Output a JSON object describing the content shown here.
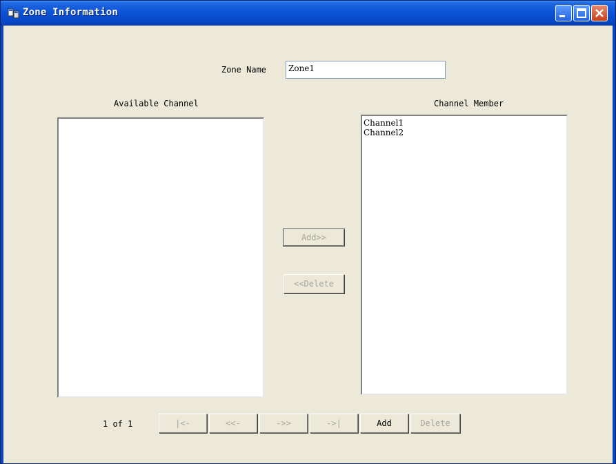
{
  "window": {
    "title": "Zone Information"
  },
  "form": {
    "zone_name_label": "Zone Name",
    "zone_name_value": "Zone1"
  },
  "available": {
    "header": "Available Channel",
    "items": []
  },
  "member": {
    "header": "Channel Member",
    "items": [
      "Channel1",
      "Channel2"
    ]
  },
  "transfer": {
    "add_label": "Add>>",
    "delete_label": "<<Delete"
  },
  "pager": {
    "page_text": "1 of 1",
    "first_label": "|<-",
    "prev_label": "<<-",
    "next_label": "->>",
    "last_label": "->|",
    "add_label": "Add",
    "delete_label": "Delete"
  },
  "colors": {
    "titlebar": "#0a52d6",
    "window_bg": "#ece9d8",
    "disabled_text": "#a7a59a"
  }
}
